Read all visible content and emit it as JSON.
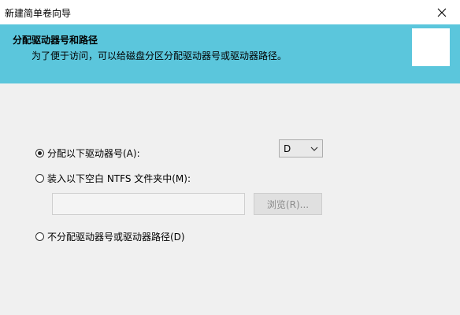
{
  "window": {
    "title": "新建简单卷向导"
  },
  "header": {
    "title": "分配驱动器号和路径",
    "description": "为了便于访问，可以给磁盘分区分配驱动器号或驱动器路径。"
  },
  "options": {
    "assign_letter": {
      "label": "分配以下驱动器号(A):",
      "checked": true
    },
    "mount_folder": {
      "label": "装入以下空白 NTFS 文件夹中(M):",
      "checked": false
    },
    "no_assign": {
      "label": "不分配驱动器号或驱动器路径(D)",
      "checked": false
    }
  },
  "drive_select": {
    "value": "D"
  },
  "folder_path": {
    "value": "",
    "placeholder": ""
  },
  "browse_button": {
    "label": "浏览(R)..."
  },
  "colors": {
    "header_bg": "#5bc6dc",
    "body_bg": "#f0f0f0",
    "disabled_text": "#8a8a8a"
  }
}
